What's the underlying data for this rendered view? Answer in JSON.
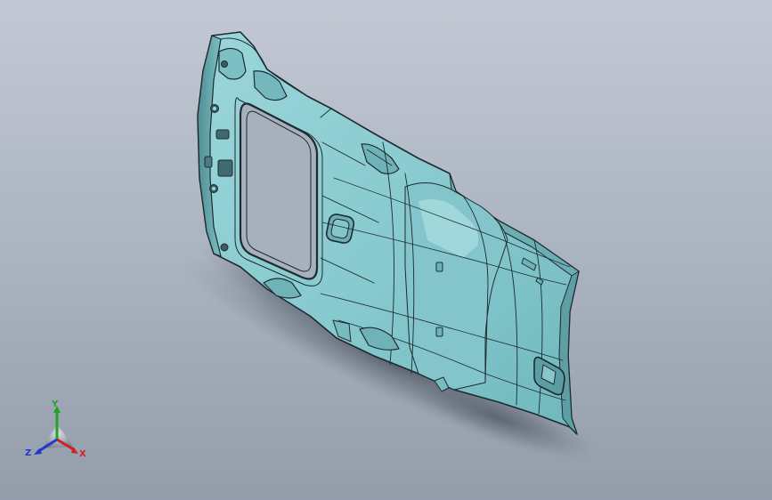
{
  "model": {
    "name": "headliner-part",
    "face_color": "#8fcfd3",
    "edge_color": "#1e2a30"
  },
  "triad": {
    "x_label": "X",
    "y_label": "Y",
    "z_label": "Z",
    "x_color": "#d21f1f",
    "y_color": "#23a323",
    "z_color": "#2337cc"
  }
}
